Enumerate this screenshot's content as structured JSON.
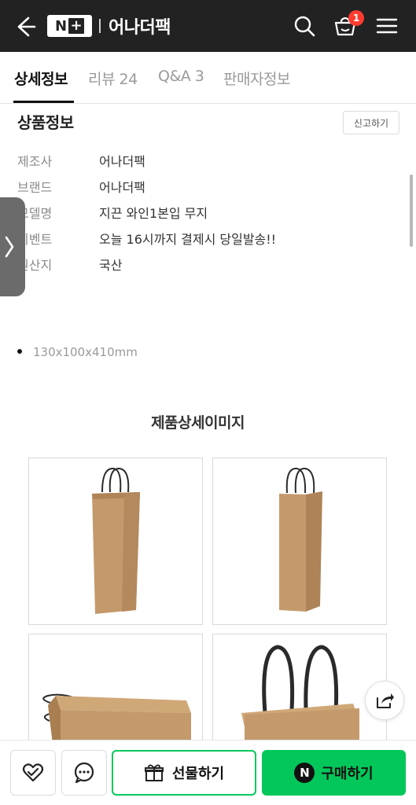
{
  "header": {
    "logo_text": "N",
    "logo_plus": "+",
    "store_name": "어나더팩",
    "cart_count": "1",
    "icons": [
      "back-arrow-icon",
      "search-icon",
      "cart-icon",
      "menu-icon"
    ]
  },
  "tabs": [
    {
      "label": "상세정보",
      "active": true
    },
    {
      "label": "리뷰 24",
      "active": false
    },
    {
      "label": "Q&A 3",
      "active": false
    },
    {
      "label": "판매자정보",
      "active": false
    }
  ],
  "product_info": {
    "title": "상품정보",
    "report_label": "신고하기",
    "rows": [
      {
        "key": "제조사",
        "value": "어나더팩"
      },
      {
        "key": "브랜드",
        "value": "어나더팩"
      },
      {
        "key": "모델명",
        "value": "지끈 와인1본입 무지"
      },
      {
        "key": "이벤트",
        "value": "오늘 16시까지 결제시 당일발송!!"
      },
      {
        "key": "원산지",
        "value": "국산"
      }
    ]
  },
  "spec": {
    "size": "130x100x410mm"
  },
  "detail": {
    "title": "제품상세이미지"
  },
  "bottom_bar": {
    "gift_label": "선물하기",
    "buy_label": "구매하기",
    "buy_logo": "N"
  },
  "colors": {
    "header_bg": "#222222",
    "accent_green": "#03c75a",
    "badge_red": "#ff3b30",
    "kraft": "#c49a6c"
  }
}
